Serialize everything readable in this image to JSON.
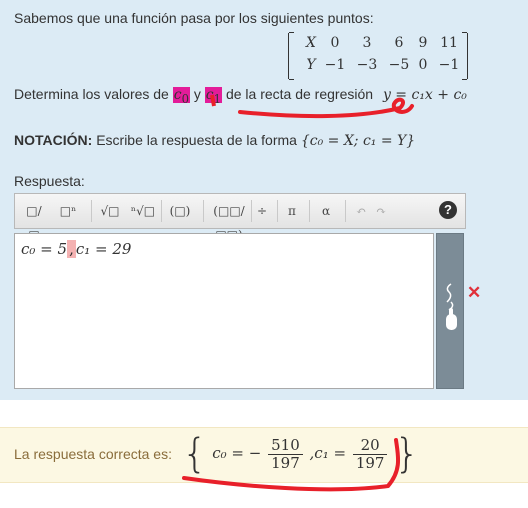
{
  "question": {
    "intro": "Sabemos que una función pasa por los siguientes puntos:",
    "matrix": {
      "row1": [
        "X",
        "0",
        "3",
        "6",
        "9",
        "11"
      ],
      "row2": [
        "Y",
        "−1",
        "−3",
        "−5",
        "0",
        "−1"
      ]
    },
    "determine_prefix": "Determina los valores de",
    "c0": "c",
    "c0_sub": "0",
    "and": "y",
    "c1": "c",
    "c1_sub": "1",
    "determine_suffix": "de la recta de regresión",
    "equation": "y = c₁x + c₀",
    "notation_bold": "NOTACIÓN:",
    "notation_text": "Escribe la respuesta de la forma",
    "notation_math": "{c₀ = X; c₁ = Y}"
  },
  "response": {
    "label": "Respuesta:",
    "answer_part1": "c₀ = 5",
    "answer_sep": ",",
    "answer_part2": "c₁ = 29",
    "toolbar": [
      "□/□",
      "□ⁿ",
      "√□",
      "ⁿ√□",
      "(□)",
      "(□□/□□)",
      "÷",
      "π",
      "α",
      "↶",
      "↷",
      "?"
    ]
  },
  "feedback": {
    "label": "La respuesta correcta es:",
    "c0_prefix": "c₀ = −",
    "c0_num": "510",
    "c0_den": "197",
    "c1_prefix": ",c₁ =",
    "c1_num": "20",
    "c1_den": "197"
  },
  "colors": {
    "panel": "#dcebf5",
    "highlight": "#e31c99",
    "annotation": "#e8202a",
    "correct_bg": "#fcf8e3"
  }
}
